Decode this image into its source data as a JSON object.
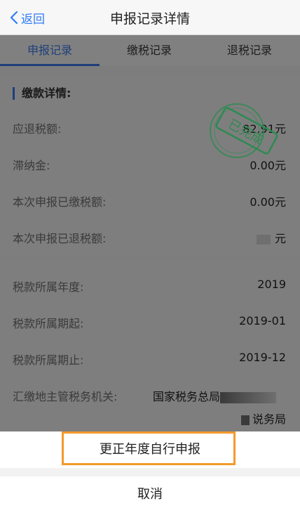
{
  "navbar": {
    "back_label": "返回",
    "title": "申报记录详情"
  },
  "tabs": [
    {
      "label": "申报记录",
      "active": true
    },
    {
      "label": "缴税记录",
      "active": false
    },
    {
      "label": "退税记录",
      "active": false
    }
  ],
  "payment": {
    "section_title": "缴款详情:",
    "stamp_text": "已完成",
    "rows": [
      {
        "label": "应退税额:",
        "value": "82.91元"
      },
      {
        "label": "滞纳金:",
        "value": "0.00元"
      },
      {
        "label": "本次申报已缴税额:",
        "value": "0.00元"
      },
      {
        "label": "本次申报已退税额:",
        "value": "元"
      }
    ]
  },
  "tax_period": {
    "rows": [
      {
        "label": "税款所属年度:",
        "value": "2019"
      },
      {
        "label": "税款所属期起:",
        "value": "2019-01"
      },
      {
        "label": "税款所属期止:",
        "value": "2019-12"
      }
    ],
    "authority_label": "汇缴地主管税务机关:",
    "authority_value_line1": "国家税务总局",
    "authority_value_line2": "说务局"
  },
  "sheet": {
    "primary_label": "更正年度自行申报",
    "cancel_label": "取消"
  },
  "colors": {
    "accent": "#2f7cf6",
    "highlight": "#f39a2c",
    "stamp": "#2e8a52"
  }
}
